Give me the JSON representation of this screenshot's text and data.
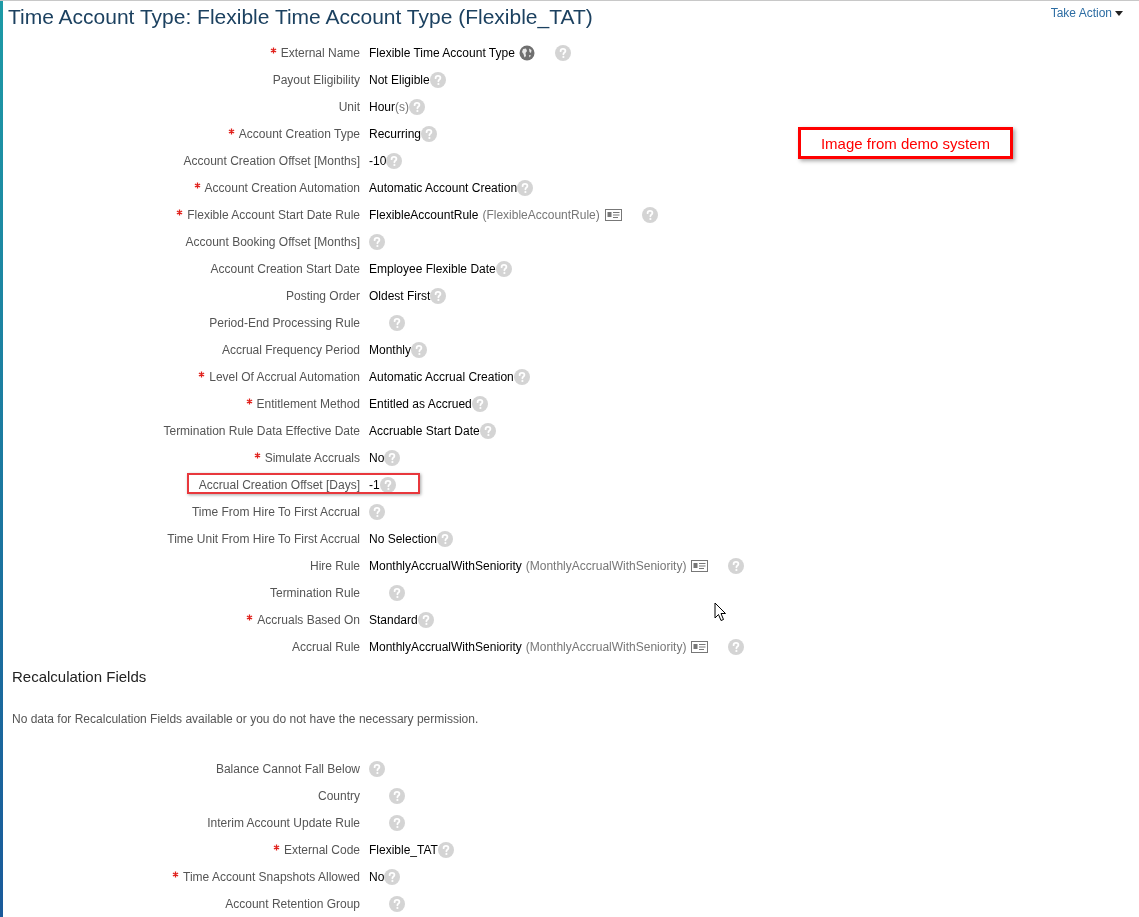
{
  "header": {
    "title": "Time Account Type: Flexible Time Account Type (Flexible_TAT)",
    "action": "Take Action"
  },
  "annotation": {
    "text": "Image from demo system"
  },
  "fields": [
    {
      "kind": "name",
      "label": "External Name",
      "required": true,
      "highlighted": false,
      "value": "Flexible Time Account Type"
    },
    {
      "kind": "text",
      "label": "Payout Eligibility",
      "required": false,
      "highlighted": false,
      "value": "Not Eligible"
    },
    {
      "kind": "unit",
      "label": "Unit",
      "required": false,
      "highlighted": false,
      "value": "Hour",
      "note": "(s)"
    },
    {
      "kind": "text",
      "label": "Account Creation Type",
      "required": true,
      "highlighted": false,
      "value": "Recurring"
    },
    {
      "kind": "text",
      "label": "Account Creation Offset [Months]",
      "required": false,
      "highlighted": false,
      "value": "-10"
    },
    {
      "kind": "text",
      "label": "Account Creation Automation",
      "required": true,
      "highlighted": false,
      "value": "Automatic Account Creation"
    },
    {
      "kind": "rule",
      "label": "Flexible Account Start Date Rule",
      "required": true,
      "highlighted": false,
      "value": "FlexibleAccountRule",
      "note": "(FlexibleAccountRule)"
    },
    {
      "kind": "blank",
      "label": "Account Booking Offset [Months]",
      "required": false,
      "highlighted": false
    },
    {
      "kind": "text",
      "label": "Account Creation Start Date",
      "required": false,
      "highlighted": false,
      "value": "Employee Flexible Date"
    },
    {
      "kind": "text",
      "label": "Posting Order",
      "required": false,
      "highlighted": false,
      "value": "Oldest First"
    },
    {
      "kind": "blank_wide",
      "label": "Period-End Processing Rule",
      "required": false,
      "highlighted": false
    },
    {
      "kind": "text",
      "label": "Accrual Frequency Period",
      "required": false,
      "highlighted": false,
      "value": "Monthly"
    },
    {
      "kind": "text",
      "label": "Level Of Accrual Automation",
      "required": true,
      "highlighted": false,
      "value": "Automatic Accrual Creation"
    },
    {
      "kind": "text",
      "label": "Entitlement Method",
      "required": true,
      "highlighted": false,
      "value": "Entitled as Accrued"
    },
    {
      "kind": "text",
      "label": "Termination Rule Data Effective Date",
      "required": false,
      "highlighted": false,
      "value": "Accruable Start Date"
    },
    {
      "kind": "text",
      "label": "Simulate Accruals",
      "required": true,
      "highlighted": false,
      "value": "No"
    },
    {
      "kind": "text",
      "label": "Accrual Creation Offset [Days]",
      "required": false,
      "highlighted": true,
      "value": "-1"
    },
    {
      "kind": "blank",
      "label": "Time From Hire To First Accrual",
      "required": false,
      "highlighted": false
    },
    {
      "kind": "text",
      "label": "Time Unit From Hire To First Accrual",
      "required": false,
      "highlighted": false,
      "value": "No Selection"
    },
    {
      "kind": "rule",
      "label": "Hire Rule",
      "required": false,
      "highlighted": false,
      "value": "MonthlyAccrualWithSeniority",
      "note": "(MonthlyAccrualWithSeniority)"
    },
    {
      "kind": "blank_wide",
      "label": "Termination Rule",
      "required": false,
      "highlighted": false
    },
    {
      "kind": "text",
      "label": "Accruals Based On",
      "required": true,
      "highlighted": false,
      "value": "Standard"
    },
    {
      "kind": "rule",
      "label": "Accrual Rule",
      "required": false,
      "highlighted": false,
      "value": "MonthlyAccrualWithSeniority",
      "note": "(MonthlyAccrualWithSeniority)"
    }
  ],
  "recalculation": {
    "heading": "Recalculation Fields",
    "message": "No data for Recalculation Fields available or you do not have the necessary permission."
  },
  "more_fields": [
    {
      "kind": "blank",
      "label": "Balance Cannot Fall Below",
      "required": false,
      "highlighted": false
    },
    {
      "kind": "blank_wide",
      "label": "Country",
      "required": false,
      "highlighted": false
    },
    {
      "kind": "blank_wide",
      "label": "Interim Account Update Rule",
      "required": false,
      "highlighted": false
    },
    {
      "kind": "text",
      "label": "External Code",
      "required": true,
      "highlighted": false,
      "value": "Flexible_TAT"
    },
    {
      "kind": "text",
      "label": "Time Account Snapshots Allowed",
      "required": true,
      "highlighted": false,
      "value": "No"
    },
    {
      "kind": "blank_wide",
      "label": "Account Retention Group",
      "required": false,
      "highlighted": false
    }
  ]
}
